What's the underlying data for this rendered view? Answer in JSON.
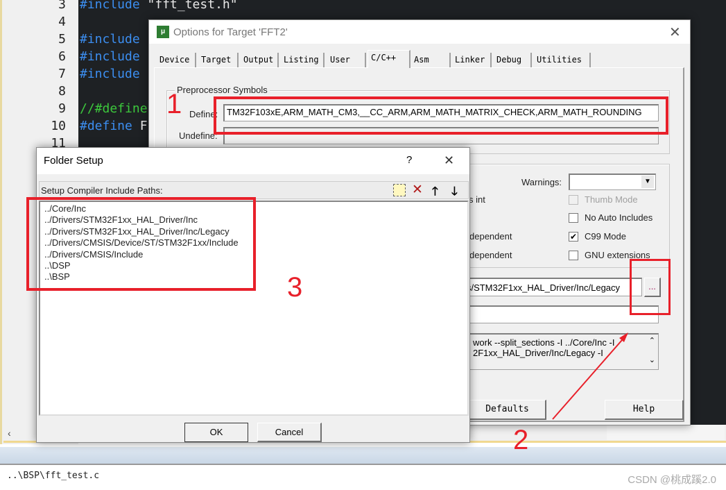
{
  "editor": {
    "lines": [
      {
        "num": "3",
        "kw": "#include",
        "rest": " \"fft_test.h\""
      },
      {
        "num": "4",
        "kw": "",
        "rest": ""
      },
      {
        "num": "5",
        "kw": "#include",
        "rest": ""
      },
      {
        "num": "6",
        "kw": "#include",
        "rest": ""
      },
      {
        "num": "7",
        "kw": "#include",
        "rest": ""
      },
      {
        "num": "8",
        "kw": "",
        "rest": ""
      },
      {
        "num": "9",
        "comment": "//#define"
      },
      {
        "num": "10",
        "kw": "#define",
        "rest": " F"
      },
      {
        "num": "11",
        "kw": "",
        "rest": ""
      }
    ]
  },
  "options_dialog": {
    "title": "Options for Target 'FFT2'",
    "tabs": [
      "Device",
      "Target",
      "Output",
      "Listing",
      "User",
      "C/C++",
      "Asm",
      "Linker",
      "Debug",
      "Utilities"
    ],
    "active_tab": "C/C++",
    "preprocessor": {
      "group_label": "Preprocessor Symbols",
      "define_label": "Define:",
      "define_value": "TM32F103xE,ARM_MATH_CM3,__CC_ARM,ARM_MATH_MATRIX_CHECK,ARM_MATH_ROUNDING",
      "undefine_label": "Undefine:",
      "undefine_value": ""
    },
    "warnings_label": "Warnings:",
    "warnings_value": "",
    "partial_labels": [
      "s int",
      "dependent",
      "dependent"
    ],
    "checkboxes": [
      {
        "label": "Thumb Mode",
        "checked": false,
        "disabled": true
      },
      {
        "label": "No Auto Includes",
        "checked": false,
        "disabled": false
      },
      {
        "label": "C99 Mode",
        "checked": true,
        "disabled": false
      },
      {
        "label": "GNU extensions",
        "checked": false,
        "disabled": false
      }
    ],
    "include_paths_value": "rs/STM32F1xx_HAL_Driver/Inc/Legacy;",
    "browse_button": "...",
    "misc_controls_value": "",
    "compiler_string": [
      "work --split_sections -I ../Core/Inc -I",
      "2F1xx_HAL_Driver/Inc/Legacy -I"
    ],
    "buttons": {
      "defaults": "Defaults",
      "help": "Help"
    }
  },
  "folder_dialog": {
    "title": "Folder Setup",
    "help": "?",
    "label": "Setup Compiler Include Paths:",
    "paths": [
      "../Core/Inc",
      "../Drivers/STM32F1xx_HAL_Driver/Inc",
      "../Drivers/STM32F1xx_HAL_Driver/Inc/Legacy",
      "../Drivers/CMSIS/Device/ST/STM32F1xx/Include",
      "../Drivers/CMSIS/Include",
      "..\\DSP",
      "..\\BSP"
    ],
    "ok": "OK",
    "cancel": "Cancel"
  },
  "annotations": {
    "one": "1",
    "two": "2",
    "three": "3",
    "color": "#e8202a"
  },
  "status": {
    "file": "..\\BSP\\fft_test.c",
    "watermark": "CSDN @桃成蹊2.0"
  }
}
